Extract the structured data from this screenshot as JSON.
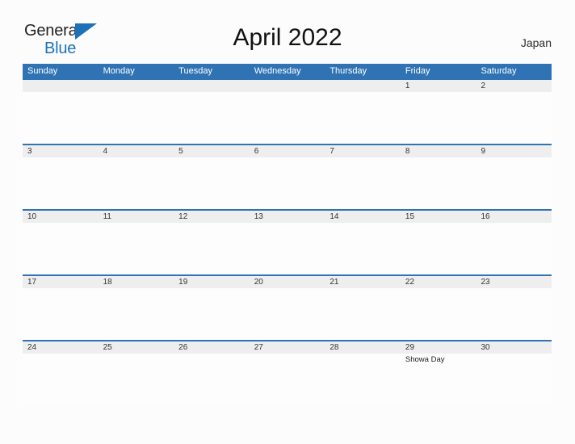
{
  "brand": {
    "line1": "General",
    "line2": "Blue",
    "flag_icon": "blue-triangle-flag-icon",
    "color_dark": "#231f20",
    "color_blue": "#1b72b8"
  },
  "header": {
    "title": "April 2022",
    "region": "Japan"
  },
  "theme": {
    "header_blue": "#3073b4",
    "band_gray": "#eeeeee",
    "page_background": "#fcfcfc",
    "text_dark": "#333333"
  },
  "calendar": {
    "day_headers": [
      "Sunday",
      "Monday",
      "Tuesday",
      "Wednesday",
      "Thursday",
      "Friday",
      "Saturday"
    ],
    "weeks": [
      {
        "dates": [
          "",
          "",
          "",
          "",
          "",
          "1",
          "2"
        ],
        "events": [
          "",
          "",
          "",
          "",
          "",
          "",
          ""
        ]
      },
      {
        "dates": [
          "3",
          "4",
          "5",
          "6",
          "7",
          "8",
          "9"
        ],
        "events": [
          "",
          "",
          "",
          "",
          "",
          "",
          ""
        ]
      },
      {
        "dates": [
          "10",
          "11",
          "12",
          "13",
          "14",
          "15",
          "16"
        ],
        "events": [
          "",
          "",
          "",
          "",
          "",
          "",
          ""
        ]
      },
      {
        "dates": [
          "17",
          "18",
          "19",
          "20",
          "21",
          "22",
          "23"
        ],
        "events": [
          "",
          "",
          "",
          "",
          "",
          "",
          ""
        ]
      },
      {
        "dates": [
          "24",
          "25",
          "26",
          "27",
          "28",
          "29",
          "30"
        ],
        "events": [
          "",
          "",
          "",
          "",
          "",
          "Showa Day",
          ""
        ]
      }
    ]
  }
}
